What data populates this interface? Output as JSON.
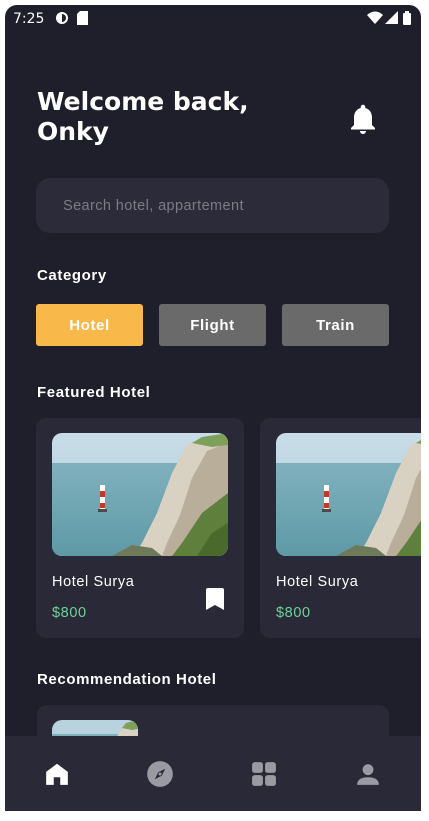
{
  "status_bar": {
    "time": "7:25"
  },
  "header": {
    "welcome": "Welcome back, Onky"
  },
  "search": {
    "placeholder": "Search hotel, appartement"
  },
  "category": {
    "title": "Category",
    "chips": [
      "Hotel",
      "Flight",
      "Train"
    ],
    "active": "Hotel"
  },
  "featured": {
    "title": "Featured Hotel",
    "hotels": [
      {
        "name": "Hotel Surya",
        "price": "$800"
      },
      {
        "name": "Hotel Surya",
        "price": "$800"
      }
    ]
  },
  "recommendation": {
    "title": "Recommendation Hotel"
  },
  "bottom_nav": {
    "items": [
      "home-icon",
      "compass-icon",
      "grid-icon",
      "profile-icon"
    ],
    "active": "home-icon"
  },
  "colors": {
    "background": "#1f1e2b",
    "card": "#2a2937",
    "accent": "#f8b84a",
    "price": "#6fd29a",
    "chip_inactive": "#6a6a6a"
  }
}
